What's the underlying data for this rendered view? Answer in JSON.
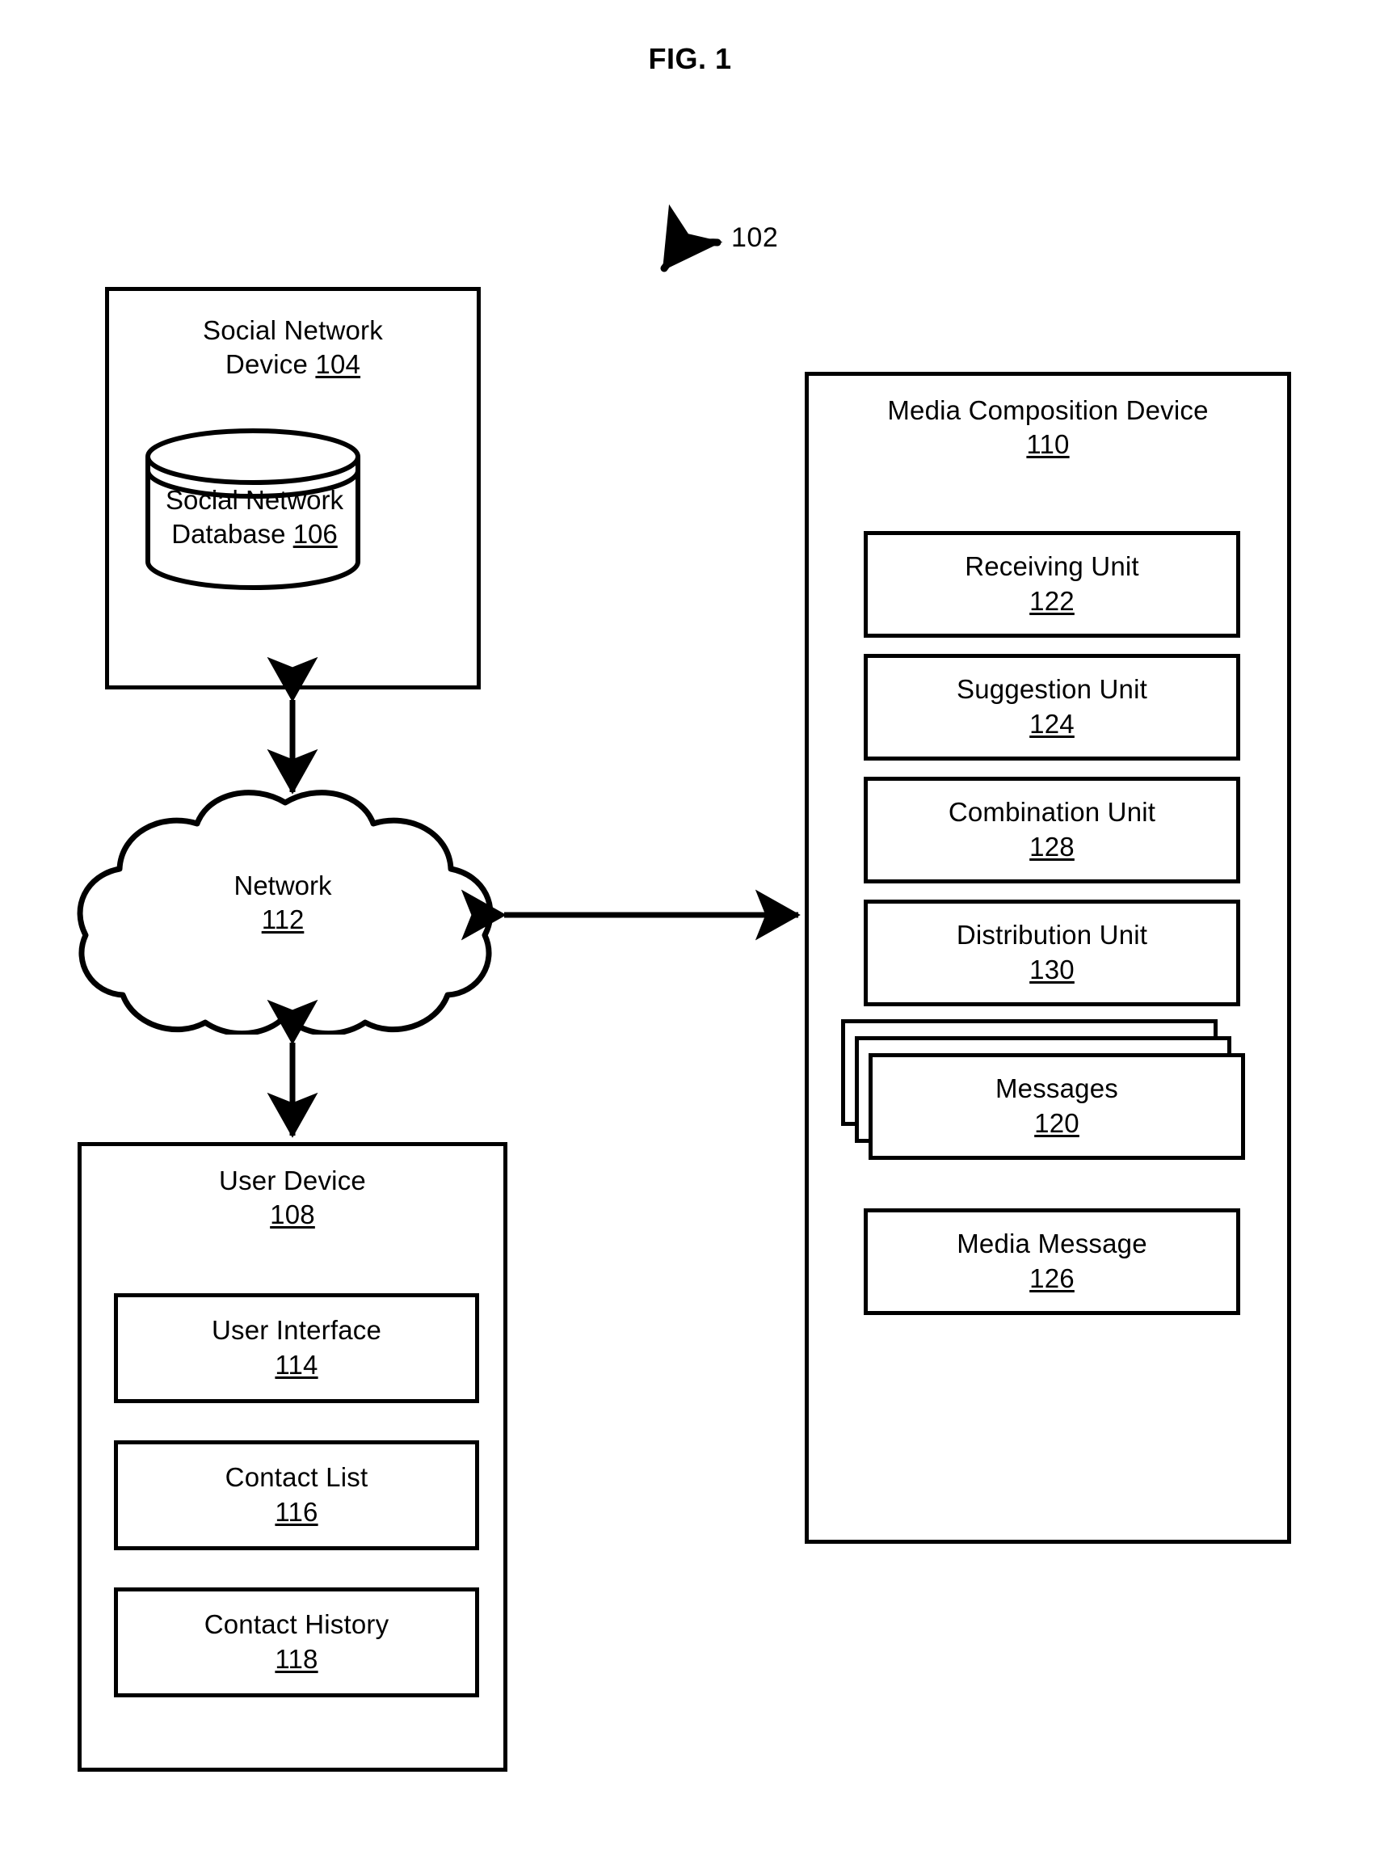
{
  "figure": {
    "title": "FIG. 1",
    "system_reference": "102"
  },
  "social_network_device": {
    "name": "Social Network",
    "name_line2": "Device",
    "ref": "104",
    "database": {
      "name": "Social Network",
      "name_line2": "Database",
      "ref": "106",
      "icon": "database-cylinder-icon"
    }
  },
  "network": {
    "name": "Network",
    "ref": "112",
    "icon": "cloud-icon"
  },
  "user_device": {
    "name": "User Device",
    "ref": "108",
    "components": [
      {
        "name": "User Interface",
        "ref": "114"
      },
      {
        "name": "Contact List",
        "ref": "116"
      },
      {
        "name": "Contact History",
        "ref": "118"
      }
    ]
  },
  "media_composition_device": {
    "name": "Media Composition Device",
    "ref": "110",
    "units": [
      {
        "name": "Receiving Unit",
        "ref": "122"
      },
      {
        "name": "Suggestion Unit",
        "ref": "124"
      },
      {
        "name": "Combination Unit",
        "ref": "128"
      },
      {
        "name": "Distribution Unit",
        "ref": "130"
      }
    ],
    "messages": {
      "name": "Messages",
      "ref": "120",
      "icon": "stacked-documents-icon"
    },
    "media_message": {
      "name": "Media Message",
      "ref": "126"
    }
  },
  "connections": [
    {
      "name": "social-network-device-to-network",
      "type": "double-arrow",
      "orientation": "vertical"
    },
    {
      "name": "network-to-user-device",
      "type": "double-arrow",
      "orientation": "vertical"
    },
    {
      "name": "network-to-media-composition-device",
      "type": "double-arrow",
      "orientation": "horizontal"
    }
  ],
  "colors": {
    "stroke": "#000000",
    "background": "#ffffff"
  }
}
